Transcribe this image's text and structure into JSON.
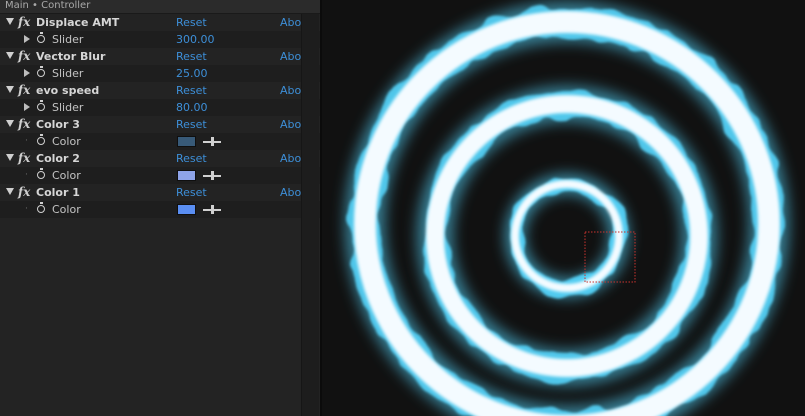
{
  "panel": {
    "title": "Main • Controller"
  },
  "effects": [
    {
      "name": "Displace AMT",
      "reset": "Reset",
      "about": "Abo",
      "param_label": "Slider",
      "param_value": "300.00"
    },
    {
      "name": "Vector Blur",
      "reset": "Reset",
      "about": "Abo",
      "param_label": "Slider",
      "param_value": "25.00"
    },
    {
      "name": "evo speed",
      "reset": "Reset",
      "about": "Abo",
      "param_label": "Slider",
      "param_value": "80.00"
    },
    {
      "name": "Color 3",
      "reset": "Reset",
      "about": "Abo",
      "param_label": "Color",
      "swatch_color": "#385a78"
    },
    {
      "name": "Color 2",
      "reset": "Reset",
      "about": "Abo",
      "param_label": "Color",
      "swatch_color": "#8ea3e8"
    },
    {
      "name": "Color 1",
      "reset": "Reset",
      "about": "Abo",
      "param_label": "Color",
      "swatch_color": "#5a8ef2"
    }
  ],
  "colors": {
    "ring_glow": "#56d8ff",
    "ring_core": "#f4fbff",
    "viewer_background": "#111111",
    "link_blue": "#3d8fd8",
    "selection_box": "#c8322e"
  },
  "icons": {
    "effect": "fx-icon",
    "collapse": "triangle-down-icon",
    "expand": "triangle-right-icon",
    "keyframe": "stopwatch-icon",
    "color_picker": "eyedropper-icon"
  }
}
